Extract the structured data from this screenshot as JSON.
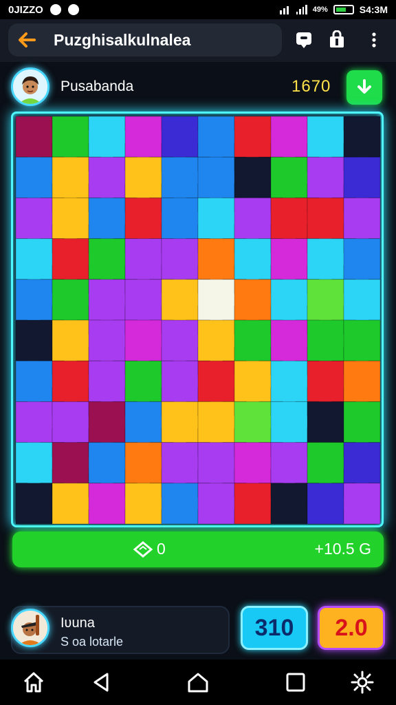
{
  "status_bar": {
    "left_text": "0JIZZO",
    "time": "S4:3M",
    "right_text": "49%"
  },
  "header": {
    "title": "Puzghisalkulnalea"
  },
  "player": {
    "name": "Pusabanda",
    "score": "1670"
  },
  "puzzle": {
    "columns": 10,
    "rows": 10,
    "colors": {
      "R": "#e8202c",
      "O": "#ff7a10",
      "Y": "#ffc21a",
      "G": "#1ec92b",
      "L": "#5fe23a",
      "C": "#2cd4f5",
      "B": "#1f86ef",
      "P": "#a83cf0",
      "M": "#d52ad9",
      "N": "#3a2bd4",
      "K": "#111830",
      "D": "#9b1050",
      "W": "#f5f5e8"
    },
    "tiles": [
      [
        "D",
        "G",
        "C",
        "M",
        "N",
        "B",
        "R",
        "M",
        "C",
        "K"
      ],
      [
        "B",
        "Y",
        "P",
        "Y",
        "B",
        "B",
        "K",
        "G",
        "P",
        "N"
      ],
      [
        "P",
        "Y",
        "B",
        "R",
        "B",
        "C",
        "P",
        "R",
        "R",
        "P"
      ],
      [
        "C",
        "R",
        "G",
        "P",
        "P",
        "O",
        "C",
        "M",
        "C",
        "B"
      ],
      [
        "B",
        "G",
        "P",
        "P",
        "Y",
        "W",
        "O",
        "C",
        "L",
        "C"
      ],
      [
        "K",
        "Y",
        "P",
        "M",
        "P",
        "Y",
        "G",
        "M",
        "G",
        "G"
      ],
      [
        "B",
        "R",
        "P",
        "G",
        "P",
        "R",
        "Y",
        "C",
        "R",
        "O"
      ],
      [
        "P",
        "P",
        "D",
        "B",
        "Y",
        "Y",
        "L",
        "C",
        "K",
        "G"
      ],
      [
        "C",
        "D",
        "B",
        "O",
        "P",
        "P",
        "M",
        "P",
        "G",
        "N"
      ],
      [
        "K",
        "Y",
        "M",
        "Y",
        "B",
        "P",
        "R",
        "K",
        "N",
        "P"
      ]
    ]
  },
  "progress": {
    "left": "0",
    "right": "+10.5 G"
  },
  "opponent": {
    "name": "Iʋuna",
    "subtitle": "S oa lotarle",
    "score_blue": "310",
    "score_orange": "2.0"
  },
  "icons": [
    "back-arrow-icon",
    "chat-icon",
    "bag-icon",
    "more-vert-icon",
    "download-icon",
    "diamond-icon",
    "home-icon",
    "nav-back-icon",
    "nav-home-icon",
    "recents-icon",
    "settings-icon"
  ]
}
